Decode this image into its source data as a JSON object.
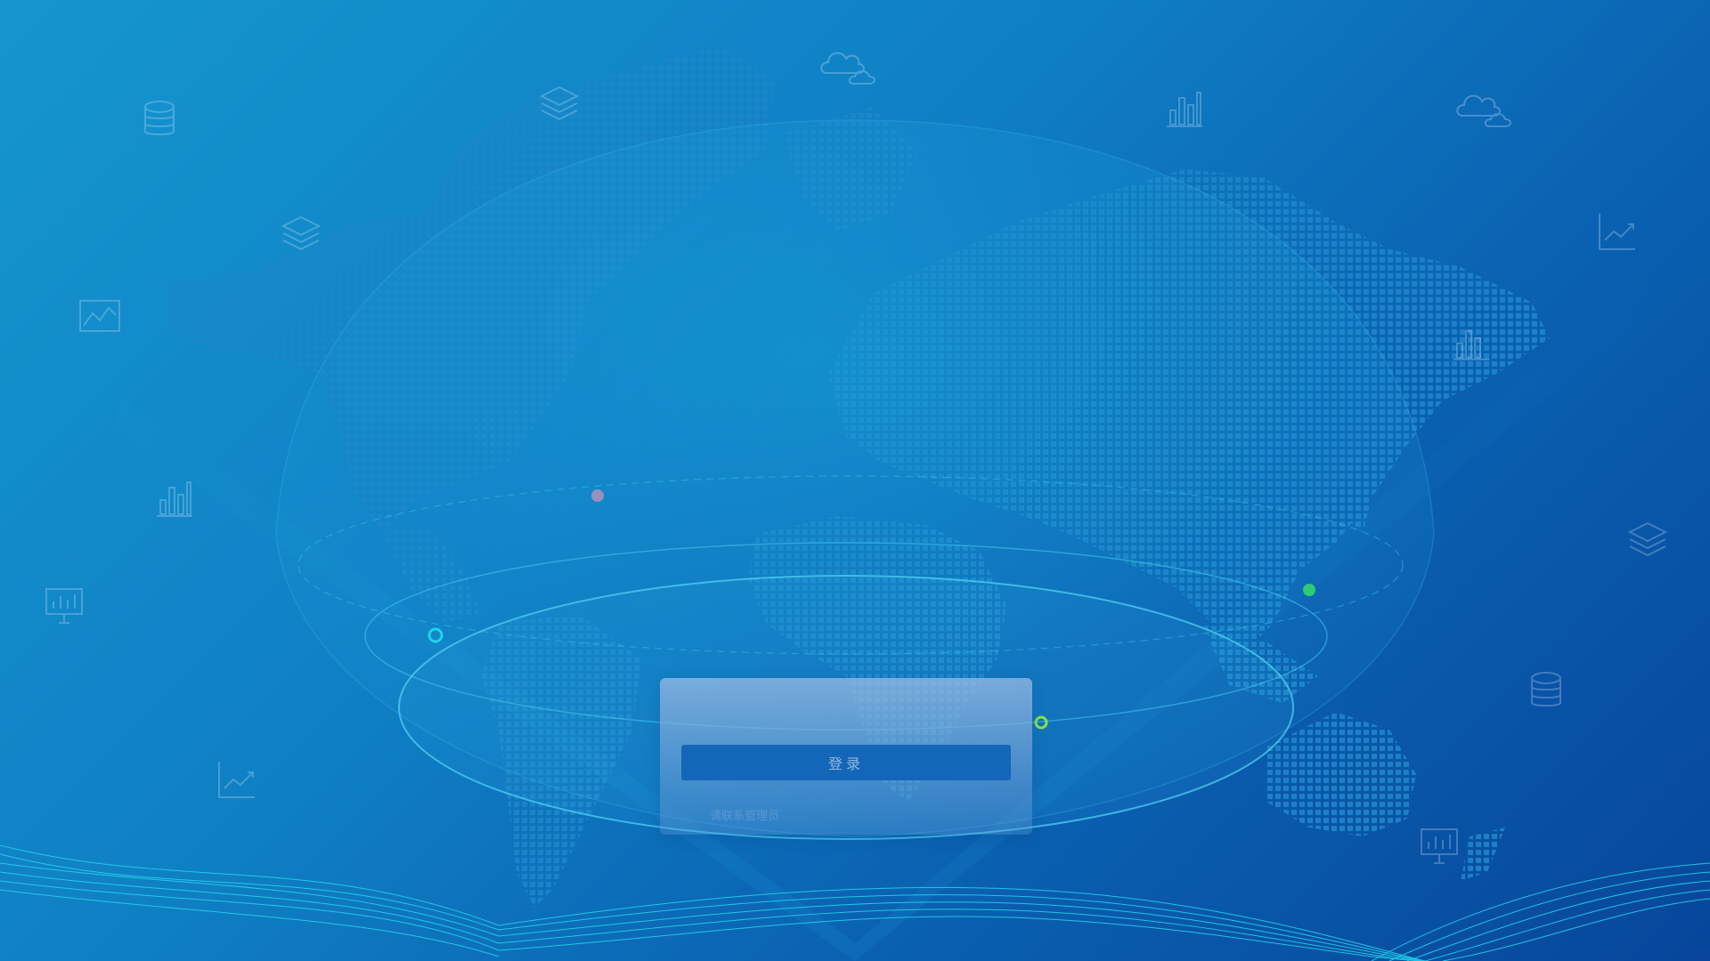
{
  "page": {
    "colors": {
      "background_start": "#1596cf",
      "background_end": "#07469a",
      "accent_cyan": "#1fd3e6",
      "accent_green": "#2ecc71",
      "button": "#1467b8"
    }
  },
  "login": {
    "button_label": "登录",
    "link_text": "请联系管理员"
  },
  "decorations": {
    "icons": [
      "database-icon",
      "layers-icon",
      "cloud-icon",
      "bar-chart-icon",
      "line-chart-icon",
      "monitor-chart-icon"
    ]
  }
}
